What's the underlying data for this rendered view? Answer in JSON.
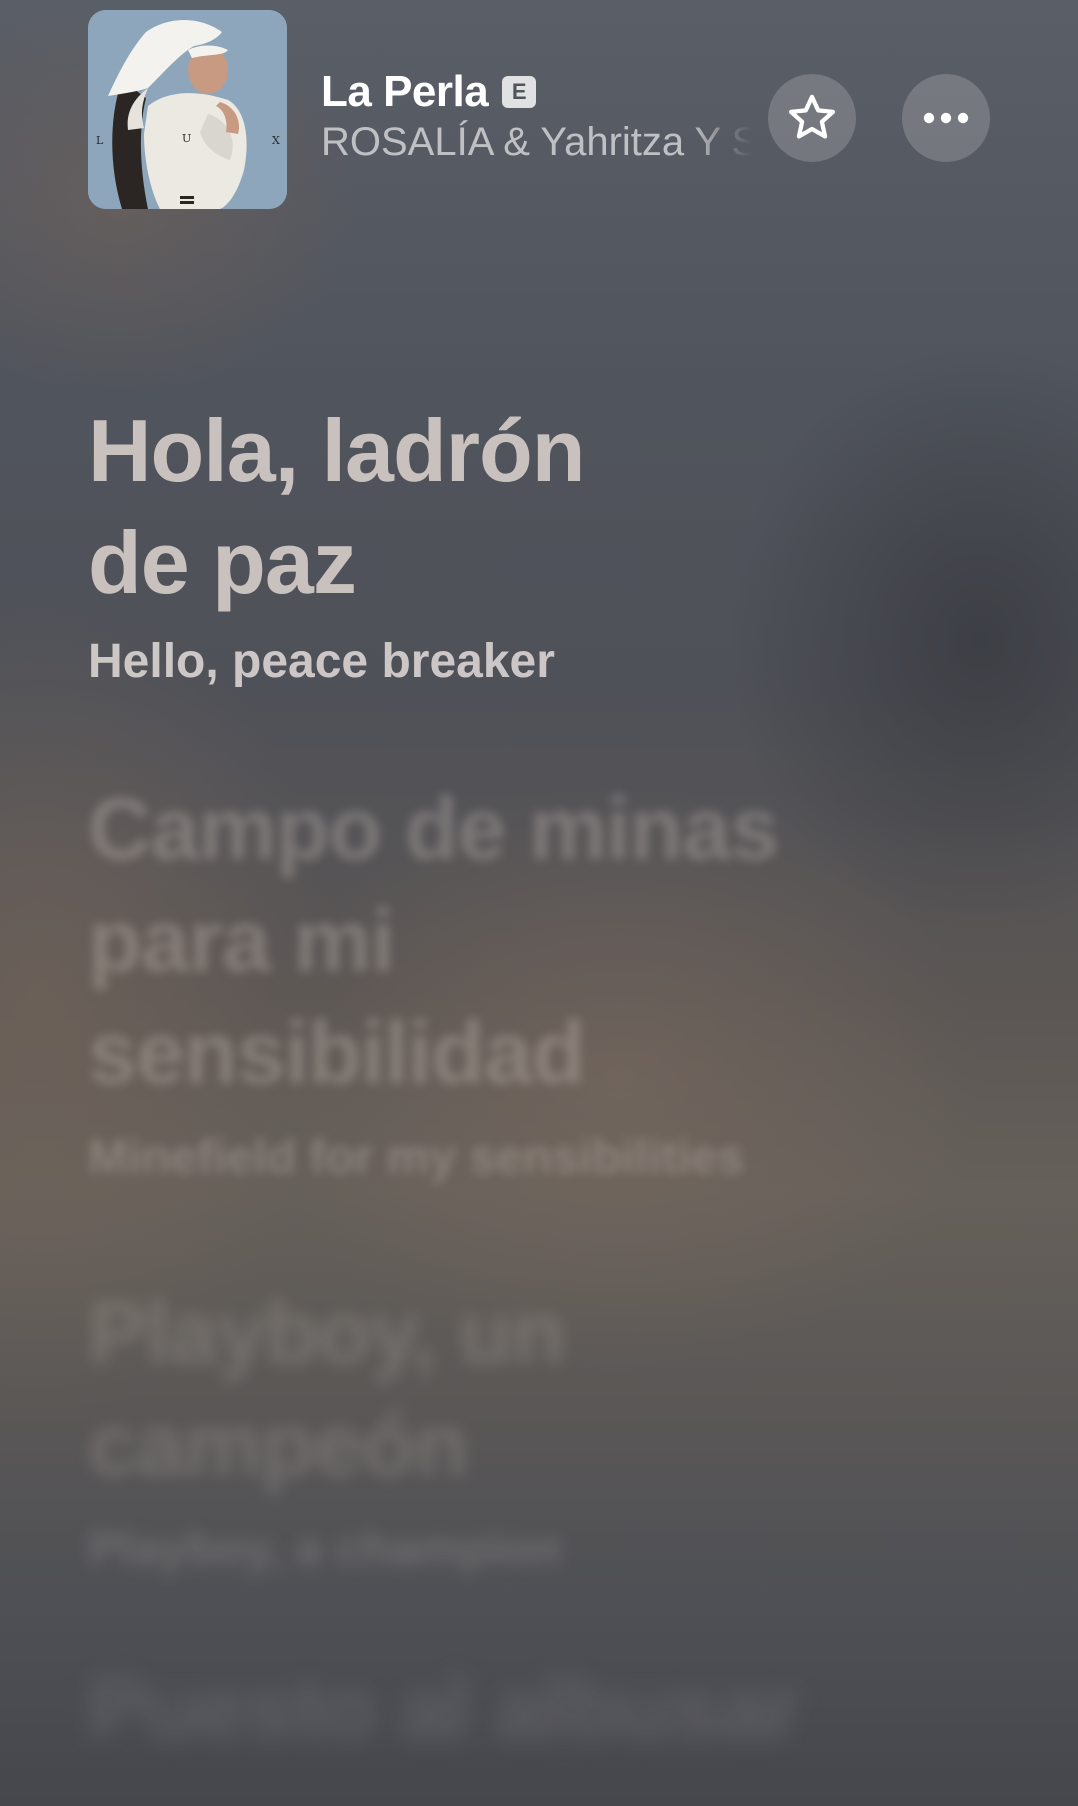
{
  "now_playing": {
    "title": "La Perla",
    "explicit_badge": "E",
    "artist": "ROSALÍA & Yahritza Y Su Esencia",
    "album_art": {
      "letters": [
        "L",
        "U",
        "X"
      ]
    }
  },
  "actions": {
    "favorite_icon": "star-icon",
    "more_icon": "ellipsis-icon"
  },
  "lyrics": [
    {
      "text": "Hola, ladrón de paz",
      "translation": "Hello, peace breaker",
      "state": "active"
    },
    {
      "text": "Campo de minas para mi sensibilidad",
      "translation": "Minefield for my sensibilities",
      "state": "upcoming"
    },
    {
      "text": "Playboy, un campeón",
      "translation": "Playboy, a champion",
      "state": "upcoming"
    },
    {
      "text": "Puesto al albusar",
      "translation": "",
      "state": "upcoming"
    }
  ],
  "colors": {
    "background": "#50545c",
    "text_primary": "#ffffff",
    "text_secondary": "#c9c9cc"
  }
}
